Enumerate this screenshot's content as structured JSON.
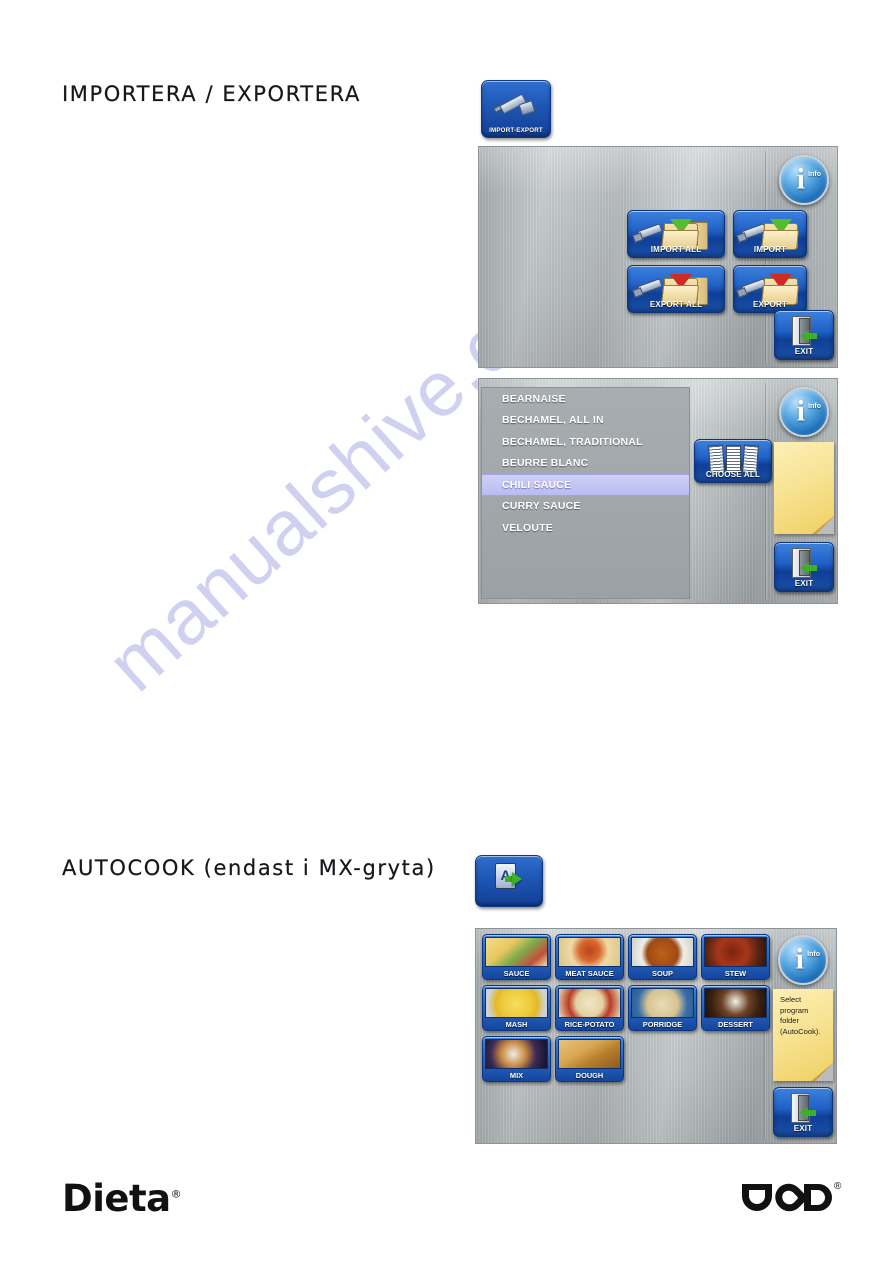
{
  "document": {
    "brand_logo": "Dieta",
    "brand_logo_mark": "®",
    "partner_logo_name": "dod-logo",
    "partner_logo_mark": "®",
    "watermark": "manualshive.com"
  },
  "sections": [
    {
      "heading": "IMPORTERA / EXPORTERA",
      "launcher": {
        "label": "IMPORT-EXPORT",
        "icon": "usb-stick-icon"
      }
    },
    {
      "heading": "AUTOCOOK (endast i MX-gryta)",
      "launcher": {
        "label": "",
        "icon": "autocook-card-arrow-icon"
      }
    }
  ],
  "import_export_screen": {
    "buttons": [
      {
        "label": "IMPORT ALL",
        "icon": "usb-folder-green-arrow-icon"
      },
      {
        "label": "IMPORT",
        "icon": "usb-folder-green-arrow-icon"
      },
      {
        "label": "EXPORT ALL",
        "icon": "usb-folder-red-arrow-icon"
      },
      {
        "label": "EXPORT",
        "icon": "usb-folder-red-arrow-icon"
      }
    ],
    "info_button": {
      "symbol": "i",
      "label": "Info"
    },
    "exit_button": {
      "label": "EXIT",
      "icon": "door-exit-icon"
    }
  },
  "recipe_list_screen": {
    "items": [
      {
        "label": "BEARNAISE",
        "selected": false
      },
      {
        "label": "BECHAMEL, ALL IN",
        "selected": false
      },
      {
        "label": "BECHAMEL, TRADITIONAL",
        "selected": false
      },
      {
        "label": "BEURRE BLANC",
        "selected": false
      },
      {
        "label": "CHILI SAUCE",
        "selected": true
      },
      {
        "label": "CURRY SAUCE",
        "selected": false
      },
      {
        "label": "VELOUTE",
        "selected": false
      }
    ],
    "choose_all_button": {
      "label": "CHOOSE ALL",
      "icon": "documents-icon"
    },
    "info_button": {
      "symbol": "i",
      "label": "Info"
    },
    "note_text": "",
    "exit_button": {
      "label": "EXIT",
      "icon": "door-exit-icon"
    }
  },
  "autocook_screen": {
    "tiles": [
      {
        "label": "SAUCE",
        "photo": "ph-sauce"
      },
      {
        "label": "MEAT SAUCE",
        "photo": "ph-meat"
      },
      {
        "label": "SOUP",
        "photo": "ph-soup"
      },
      {
        "label": "STEW",
        "photo": "ph-stew"
      },
      {
        "label": "MASH",
        "photo": "ph-mash"
      },
      {
        "label": "RICE-POTATO",
        "photo": "ph-rice"
      },
      {
        "label": "PORRIDGE",
        "photo": "ph-porridge"
      },
      {
        "label": "DESSERT",
        "photo": "ph-dessert"
      },
      {
        "label": "MIX",
        "photo": "ph-mix"
      },
      {
        "label": "DOUGH",
        "photo": "ph-dough"
      }
    ],
    "info_button": {
      "symbol": "i",
      "label": "Info"
    },
    "note_text": "Select program folder (AutoCook).",
    "exit_button": {
      "label": "EXIT",
      "icon": "door-exit-icon"
    }
  },
  "colors": {
    "button_blue": "#2061c6",
    "accent_green": "#3fae2a",
    "accent_red": "#cf2b25",
    "selection": "#c4c6f2",
    "note_yellow": "#f8e394",
    "panel_grey": "#b5babc"
  }
}
